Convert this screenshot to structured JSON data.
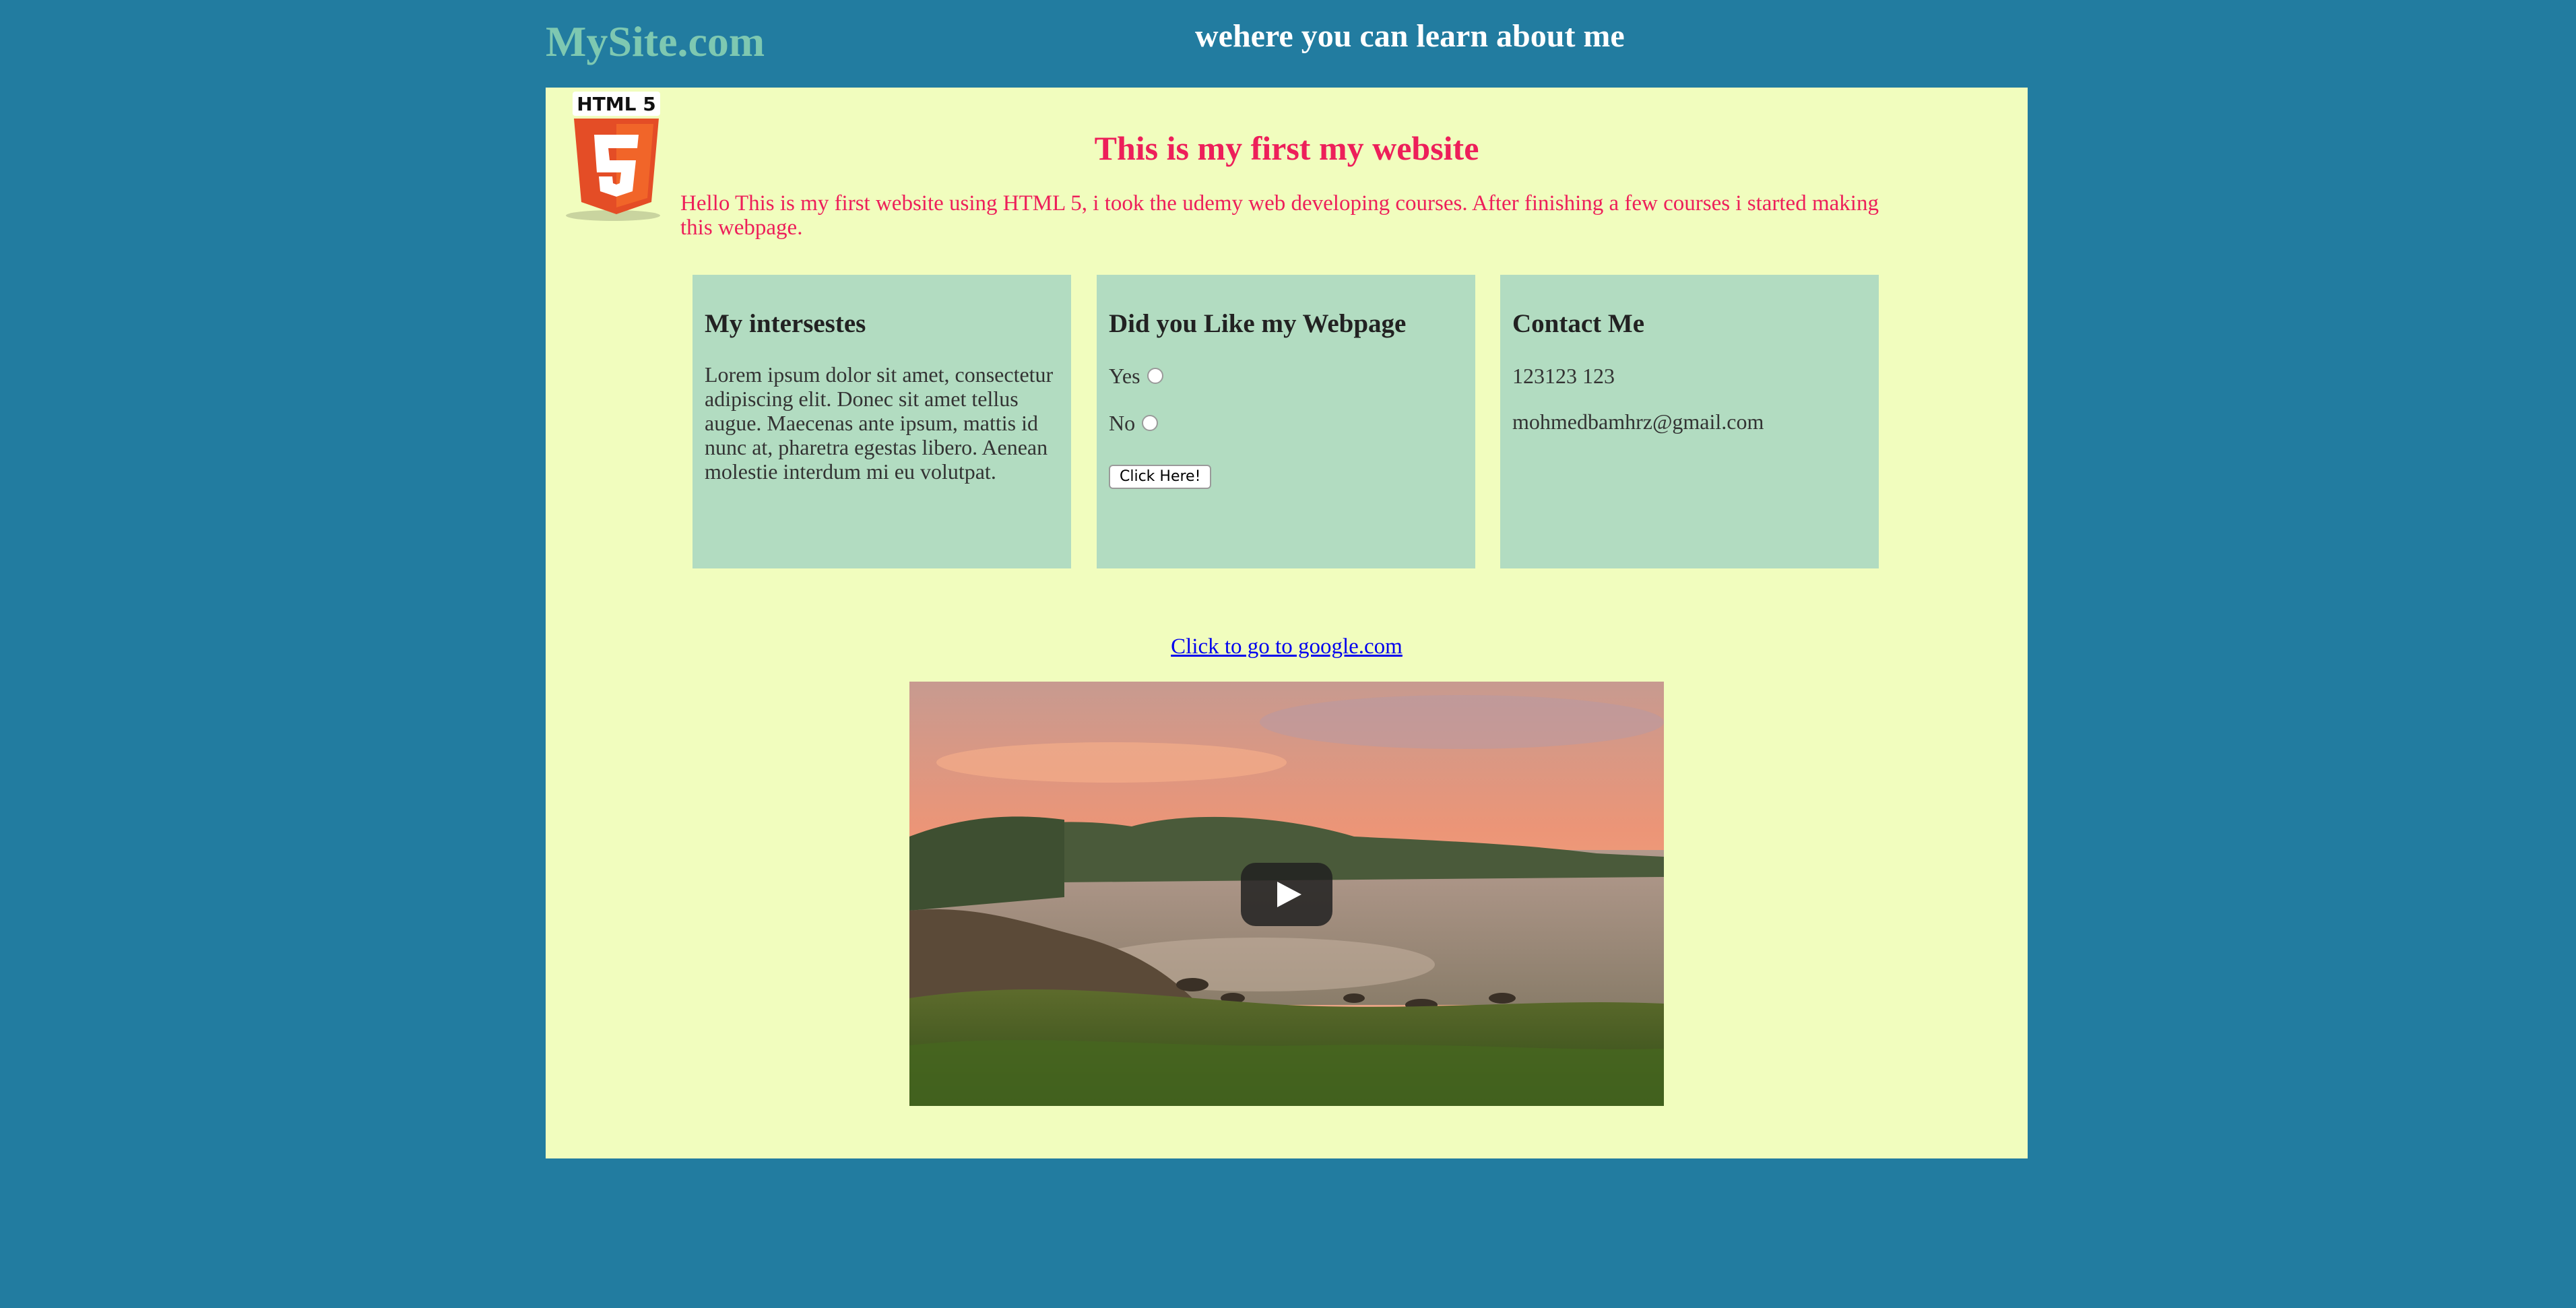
{
  "header": {
    "logo": "MySite.com",
    "tagline": "wehere you can learn about me"
  },
  "main": {
    "heading": "This is my first my website",
    "intro": "Hello This is my first website using HTML 5, i took the udemy web developing courses. After finishing a few courses i started making this webpage.",
    "html5_badge": "HTML 5"
  },
  "cards": {
    "interests": {
      "title": "My intersestes",
      "body": "Lorem ipsum dolor sit amet, consectetur adipiscing elit. Donec sit amet tellus augue. Maecenas ante ipsum, mattis id nunc at, pharetra egestas libero. Aenean molestie interdum mi eu volutpat."
    },
    "feedback": {
      "title": "Did you Like my Webpage",
      "yes_label": "Yes",
      "no_label": "No",
      "button_label": "Click Here!"
    },
    "contact": {
      "title": "Contact Me",
      "phone": "123123 123",
      "email": "mohmedbamhrz@gmail.com"
    }
  },
  "link": {
    "text": "Click to go to google.com"
  },
  "video": {
    "icon": "play-icon"
  },
  "colors": {
    "page_background": "#227ca0",
    "panel_background": "#f1fdbe",
    "card_background": "#b2dcc1",
    "heading_accent": "#ed1f5a",
    "logo_color": "#7ec8b1",
    "link_color": "#0000ee"
  }
}
